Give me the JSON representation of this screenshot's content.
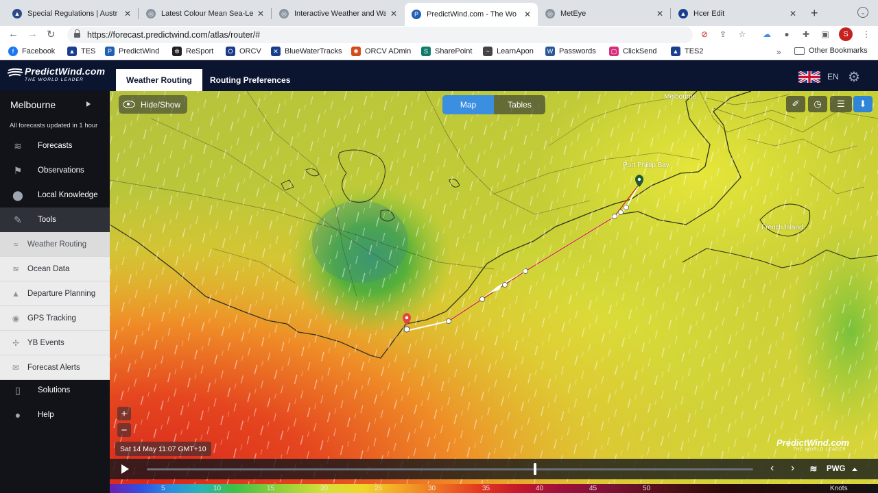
{
  "browser": {
    "tabs": [
      {
        "title": "Special Regulations | Austr",
        "favicon": "ra-icon",
        "color": "#2a4a8a"
      },
      {
        "title": "Latest Colour Mean Sea-Le",
        "favicon": "globe-icon",
        "color": "#8a93a0"
      },
      {
        "title": "Interactive Weather and Wa",
        "favicon": "globe-icon",
        "color": "#8a93a0"
      },
      {
        "title": "PredictWind.com - The Wo",
        "favicon": "predictwind-icon",
        "color": "#1f5fb4",
        "active": true
      },
      {
        "title": "MetEye",
        "favicon": "globe-icon",
        "color": "#8a93a0"
      },
      {
        "title": "Hcer Edit",
        "favicon": "sail-icon",
        "color": "#1a3f8f"
      }
    ],
    "close_glyph": "✕",
    "new_tab_glyph": "+",
    "url": "https://forecast.predictwind.com/atlas/router/#",
    "profile_initial": "S",
    "bookmarks": [
      {
        "label": "Facebook",
        "icon": "facebook-icon",
        "color": "#1877f2",
        "glyph": "f"
      },
      {
        "label": "TES",
        "icon": "sail-icon",
        "color": "#1a3f8f",
        "glyph": "▲"
      },
      {
        "label": "PredictWind",
        "icon": "predictwind-icon",
        "color": "#1f5fb4",
        "glyph": "P"
      },
      {
        "label": "ReSport",
        "icon": "gear-icon",
        "color": "#222222",
        "glyph": "✲"
      },
      {
        "label": "ORCV",
        "icon": "orcv-icon",
        "color": "#1a3a8a",
        "glyph": "O"
      },
      {
        "label": "BlueWaterTracks",
        "icon": "bwt-icon",
        "color": "#163e8c",
        "glyph": "✕"
      },
      {
        "label": "ORCV ADmin",
        "icon": "crab-icon",
        "color": "#d34a1a",
        "glyph": "✺"
      },
      {
        "label": "SharePoint",
        "icon": "sharepoint-icon",
        "color": "#0f7b6c",
        "glyph": "S"
      },
      {
        "label": "LearnApon",
        "icon": "learnapon-icon",
        "color": "#444444",
        "glyph": "~"
      },
      {
        "label": "Passwords",
        "icon": "word-icon",
        "color": "#2b579a",
        "glyph": "W"
      },
      {
        "label": "ClickSend",
        "icon": "clicksend-icon",
        "color": "#d62d7e",
        "glyph": "▢"
      },
      {
        "label": "TES2",
        "icon": "sail-icon",
        "color": "#1a3f8f",
        "glyph": "▲"
      }
    ],
    "more_glyph": "»",
    "other_bookmarks": "Other Bookmarks"
  },
  "app": {
    "logo_text": "PredictWind.com",
    "logo_sub": "THE WORLD LEADER",
    "tabs": [
      "Weather Routing",
      "Routing Preferences"
    ],
    "lang": "EN"
  },
  "sidebar": {
    "location": "Melbourne",
    "updated": "All forecasts updated in 1 hour",
    "items": [
      {
        "label": "Forecasts",
        "icon": "wind-lines-icon",
        "glyph": "≋"
      },
      {
        "label": "Observations",
        "icon": "flag-icon",
        "glyph": "⚑"
      },
      {
        "label": "Local Knowledge",
        "icon": "pin-icon",
        "glyph": "⬤"
      },
      {
        "label": "Tools",
        "icon": "wrench-icon",
        "glyph": "✎"
      }
    ],
    "sub_items": [
      {
        "label": "Weather Routing",
        "icon": "route-icon",
        "glyph": "≈"
      },
      {
        "label": "Ocean Data",
        "icon": "waves-icon",
        "glyph": "≋"
      },
      {
        "label": "Departure Planning",
        "icon": "mountain-icon",
        "glyph": "▲"
      },
      {
        "label": "GPS Tracking",
        "icon": "location-icon",
        "glyph": "◉"
      },
      {
        "label": "YB Events",
        "icon": "yb-icon",
        "glyph": "✢"
      },
      {
        "label": "Forecast Alerts",
        "icon": "envelope-icon",
        "glyph": "✉"
      }
    ],
    "bottom_items": [
      {
        "label": "Solutions",
        "icon": "phone-icon",
        "glyph": "▯"
      },
      {
        "label": "Help",
        "icon": "help-icon",
        "glyph": "●"
      }
    ]
  },
  "map": {
    "hide_show": "Hide/Show",
    "view_toggle": [
      "Map",
      "Tables"
    ],
    "tools": [
      {
        "name": "route-edit-icon",
        "glyph": "✐"
      },
      {
        "name": "clock-icon",
        "glyph": "◷"
      },
      {
        "name": "layers-icon",
        "glyph": "☰"
      },
      {
        "name": "download-icon",
        "glyph": "⬇"
      }
    ],
    "zoom_in": "+",
    "zoom_out": "−",
    "labels": [
      "Melbourne",
      "Port Phillip Bay",
      "French Island"
    ],
    "timestamp": "Sat 14 May 11:07 GMT+10",
    "watermark_text": "PredictWind.com",
    "watermark_sub": "THE WORLD LEADER",
    "player": {
      "progress": 0.64,
      "prev": "‹",
      "next": "›",
      "model": "PWG"
    }
  },
  "legend": {
    "ticks": [
      "5",
      "10",
      "15",
      "20",
      "25",
      "30",
      "35",
      "40",
      "45",
      "50"
    ],
    "unit": "Knots"
  }
}
